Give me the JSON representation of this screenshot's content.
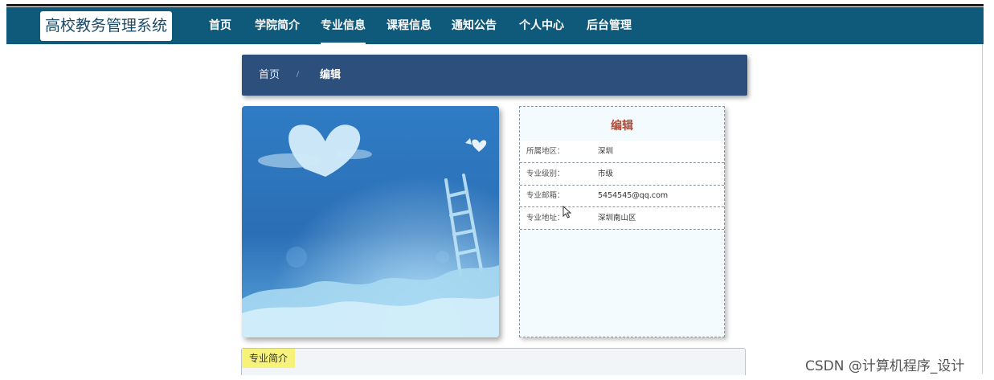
{
  "header": {
    "brand": "高校教务管理系统",
    "nav": [
      {
        "label": "首页"
      },
      {
        "label": "学院简介"
      },
      {
        "label": "专业信息",
        "active": true
      },
      {
        "label": "课程信息"
      },
      {
        "label": "通知公告"
      },
      {
        "label": "个人中心"
      },
      {
        "label": "后台管理"
      }
    ]
  },
  "breadcrumb": {
    "home": "首页",
    "separator": "/",
    "current": "编辑"
  },
  "detail": {
    "title": "编辑",
    "rows": [
      {
        "label": "所属地区：",
        "value": "深圳"
      },
      {
        "label": "专业级别：",
        "value": "市级"
      },
      {
        "label": "专业邮箱：",
        "value": "5454545@qq.com"
      },
      {
        "label": "专业地址：",
        "value": "深圳南山区"
      }
    ]
  },
  "intro": {
    "tab_label": "专业简介"
  },
  "watermark": "CSDN @计算机程序_设计",
  "icons": {
    "hero_image": "sky-heart-cloud-ladder-image",
    "cursor": "mouse-pointer-icon"
  },
  "colors": {
    "navbar": "#0f5a7a",
    "breadcrumb_bar": "#2c4f7c",
    "detail_title": "#b24a34",
    "intro_tab": "#f6f27a"
  }
}
